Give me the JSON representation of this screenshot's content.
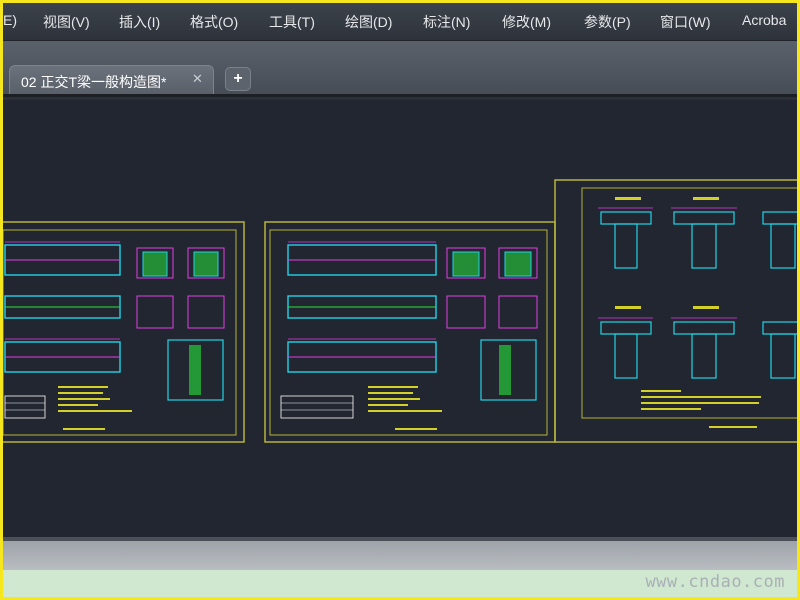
{
  "menubar": {
    "items": [
      "E)",
      "视图(V)",
      "插入(I)",
      "格式(O)",
      "工具(T)",
      "绘图(D)",
      "标注(N)",
      "修改(M)",
      "参数(P)",
      "窗口(W)",
      "Acroba"
    ]
  },
  "tabs": {
    "active_label": "02 正交T梁一般构造图*",
    "close_glyph": "✕",
    "new_tab_glyph": "+"
  },
  "watermark": "www.cndao.com",
  "colors": {
    "canvas_bg": "#212630",
    "frame_border": "#b7b33c",
    "cyan": "#22d3e6",
    "magenta": "#e53de8",
    "green": "#26e43c",
    "yellow": "#d4d02a",
    "white": "#ffffff"
  }
}
